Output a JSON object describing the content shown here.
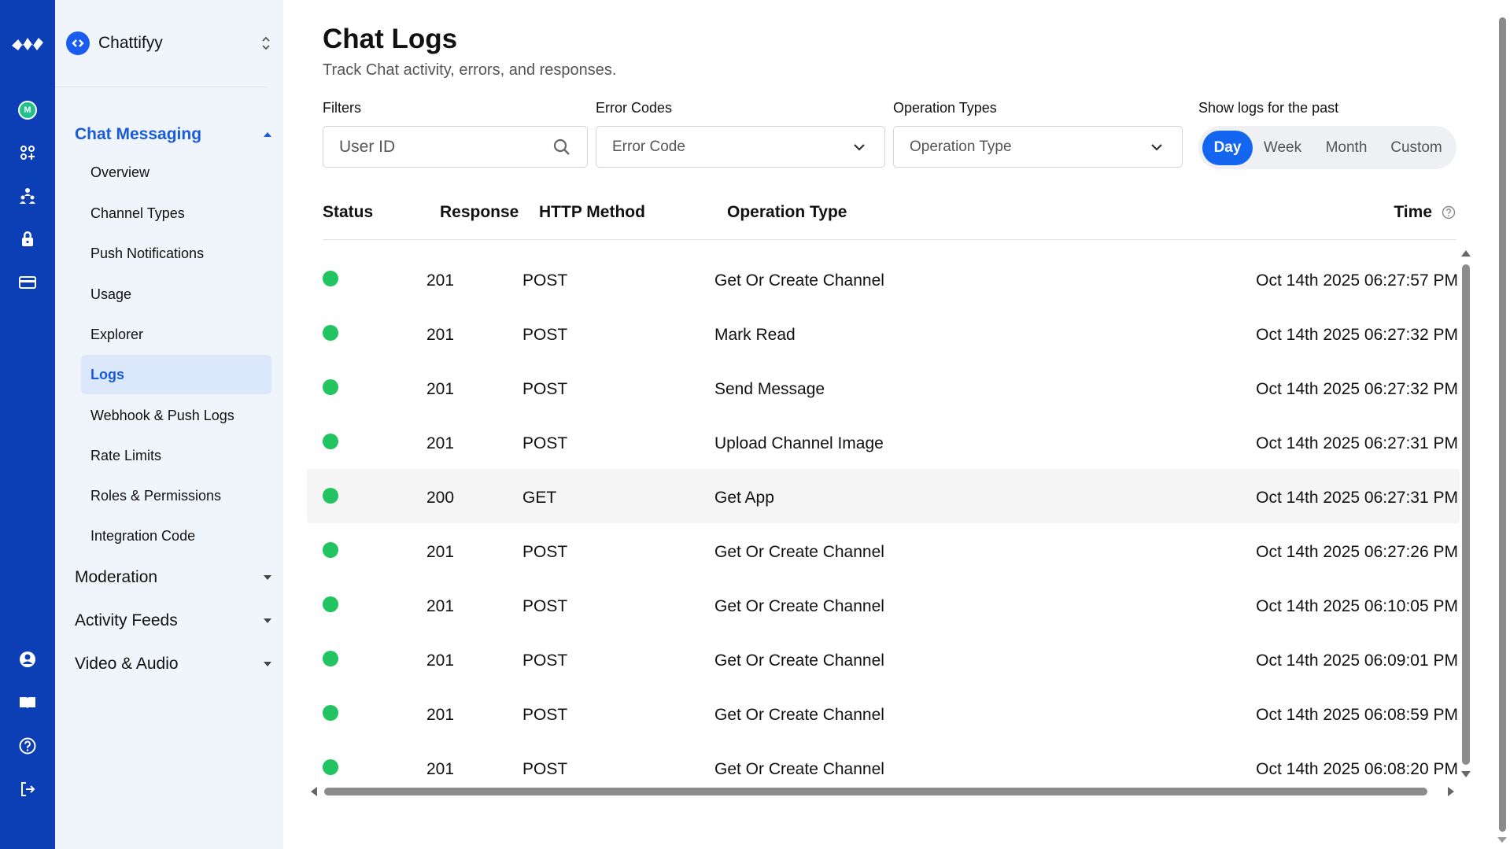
{
  "rail": {
    "items": [
      {
        "name": "brand-logo-icon"
      },
      {
        "name": "org-avatar-icon",
        "letter": "M"
      },
      {
        "name": "apps-grid-icon"
      },
      {
        "name": "team-icon"
      },
      {
        "name": "lock-icon"
      },
      {
        "name": "billing-card-icon"
      },
      {
        "name": "profile-icon"
      },
      {
        "name": "docs-book-icon"
      },
      {
        "name": "help-icon"
      },
      {
        "name": "logout-icon"
      }
    ]
  },
  "app_switcher": {
    "name": "Chattifyy"
  },
  "sidebar": {
    "chat_group": "Chat Messaging",
    "items": [
      "Overview",
      "Channel Types",
      "Push Notifications",
      "Usage",
      "Explorer",
      "Logs",
      "Webhook & Push Logs",
      "Rate Limits",
      "Roles & Permissions",
      "Integration Code"
    ],
    "active_index": 5,
    "other_groups": [
      "Moderation",
      "Activity Feeds",
      "Video & Audio"
    ]
  },
  "page": {
    "title": "Chat Logs",
    "subtitle": "Track Chat activity, errors, and responses."
  },
  "filters": {
    "filters_label": "Filters",
    "user_id_placeholder": "User ID",
    "error_codes_label": "Error Codes",
    "error_code_value": "Error Code",
    "operation_types_label": "Operation Types",
    "operation_type_value": "Operation Type",
    "period_label": "Show logs for the past",
    "periods": [
      "Day",
      "Week",
      "Month",
      "Custom"
    ],
    "active_period": "Day"
  },
  "table": {
    "headers": {
      "status": "Status",
      "response": "Response",
      "method": "HTTP Method",
      "operation": "Operation Type",
      "time": "Time"
    },
    "rows": [
      {
        "status": "success",
        "response": "201",
        "method": "POST",
        "operation": "Get Or Create Channel",
        "time": "Oct 14th 2025 06:27:57 PM"
      },
      {
        "status": "success",
        "response": "201",
        "method": "POST",
        "operation": "Mark Read",
        "time": "Oct 14th 2025 06:27:32 PM"
      },
      {
        "status": "success",
        "response": "201",
        "method": "POST",
        "operation": "Send Message",
        "time": "Oct 14th 2025 06:27:32 PM"
      },
      {
        "status": "success",
        "response": "201",
        "method": "POST",
        "operation": "Upload Channel Image",
        "time": "Oct 14th 2025 06:27:31 PM"
      },
      {
        "status": "success",
        "response": "200",
        "method": "GET",
        "operation": "Get App",
        "time": "Oct 14th 2025 06:27:31 PM"
      },
      {
        "status": "success",
        "response": "201",
        "method": "POST",
        "operation": "Get Or Create Channel",
        "time": "Oct 14th 2025 06:27:26 PM"
      },
      {
        "status": "success",
        "response": "201",
        "method": "POST",
        "operation": "Get Or Create Channel",
        "time": "Oct 14th 2025 06:10:05 PM"
      },
      {
        "status": "success",
        "response": "201",
        "method": "POST",
        "operation": "Get Or Create Channel",
        "time": "Oct 14th 2025 06:09:01 PM"
      },
      {
        "status": "success",
        "response": "201",
        "method": "POST",
        "operation": "Get Or Create Channel",
        "time": "Oct 14th 2025 06:08:59 PM"
      },
      {
        "status": "success",
        "response": "201",
        "method": "POST",
        "operation": "Get Or Create Channel",
        "time": "Oct 14th 2025 06:08:20 PM"
      }
    ]
  },
  "colors": {
    "rail": "#0c3fb6",
    "sidebar": "#f0f4fb",
    "accent": "#1466f0",
    "success": "#21c461"
  }
}
